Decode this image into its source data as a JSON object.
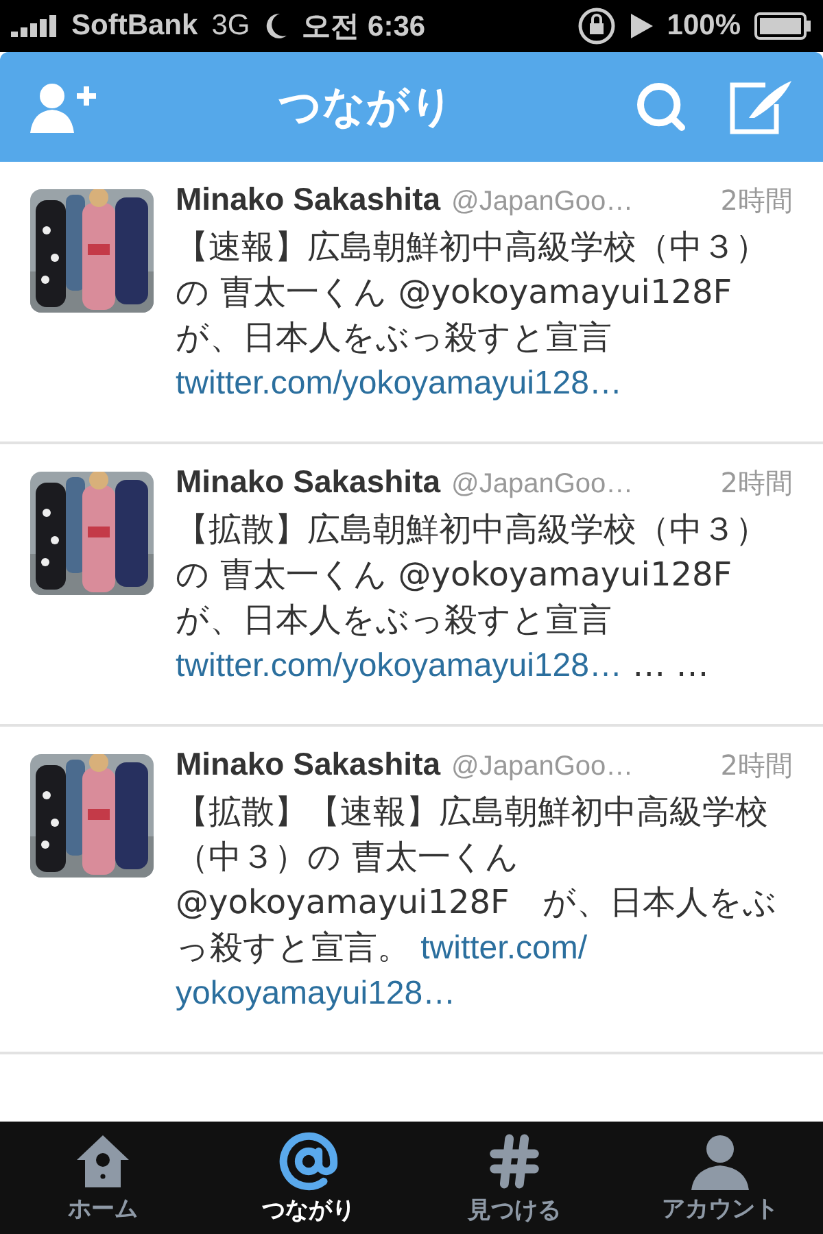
{
  "status_bar": {
    "carrier": "SoftBank",
    "network": "3G",
    "time": "오전 6:36",
    "battery": "100%"
  },
  "nav_bar": {
    "title": "つながり"
  },
  "tweets": [
    {
      "name": "Minako Sakashita",
      "handle": "@JapanGoo…",
      "time": "2時間",
      "avatar": {
        "kind": "picture"
      },
      "body": [
        {
          "kind": "text",
          "text": "【速報】広島朝鮮初中高級学校（中３）の 曺太一くん @yokoyamayui128F　が、日本人をぶっ殺すと宣言"
        },
        {
          "kind": "break"
        },
        {
          "kind": "link",
          "text": "twitter.com/yokoyamayui128…"
        }
      ]
    },
    {
      "name": "Minako Sakashita",
      "handle": "@JapanGoo…",
      "time": "2時間",
      "avatar": {
        "kind": "picture"
      },
      "body": [
        {
          "kind": "text",
          "text": "【拡散】広島朝鮮初中高級学校（中３）の 曺太一くん @yokoyamayui128F　が、日本人をぶっ殺すと宣言"
        },
        {
          "kind": "break"
        },
        {
          "kind": "link",
          "text": "twitter.com/yokoyamayui128…"
        },
        {
          "kind": "text",
          "text": " … …"
        }
      ]
    },
    {
      "name": "Minako Sakashita",
      "handle": "@JapanGoo…",
      "time": "2時間",
      "avatar": {
        "kind": "picture"
      },
      "body": [
        {
          "kind": "text",
          "text": "【拡散】【速報】広島朝鮮初中高級学校（中３）の 曺太一くん @yokoyamayui128F　が、日本人をぶっ殺すと宣言。 "
        },
        {
          "kind": "link",
          "text": "twitter.com/"
        },
        {
          "kind": "break"
        },
        {
          "kind": "link",
          "text": "yokoyamayui128…"
        }
      ]
    }
  ],
  "tab_bar": [
    {
      "label": "ホーム",
      "kind": "home",
      "selected": false
    },
    {
      "label": "つながり",
      "kind": "mentions",
      "selected": true
    },
    {
      "label": "見つける",
      "kind": "discover",
      "selected": false
    },
    {
      "label": "アカウント",
      "kind": "account",
      "selected": false
    }
  ]
}
